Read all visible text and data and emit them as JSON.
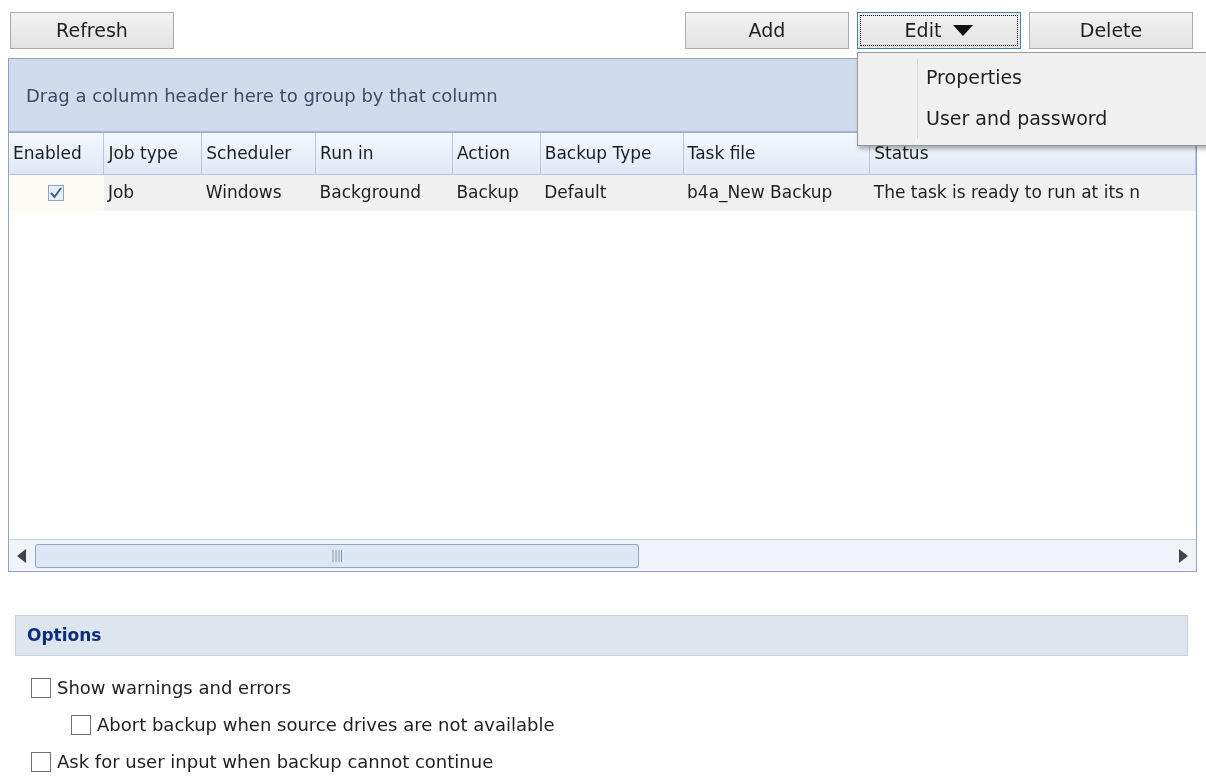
{
  "toolbar": {
    "left_buttons": [
      {
        "label": "Refresh"
      }
    ],
    "right_buttons": [
      {
        "label": "Add",
        "kind": "plain"
      },
      {
        "label": "Edit",
        "kind": "dropdown",
        "expanded": true
      },
      {
        "label": "Delete",
        "kind": "plain"
      }
    ]
  },
  "menu": {
    "items": [
      {
        "label": "Properties"
      },
      {
        "label": "User and password"
      }
    ]
  },
  "grid": {
    "group_hint": "Drag a column header here to group by that column",
    "columns": [
      "Enabled",
      "Job type",
      "Scheduler",
      "Run in",
      "Action",
      "Backup Type",
      "Task file",
      "Status"
    ],
    "rows": [
      {
        "cells": [
          {
            "kind": "checkbox",
            "checked": true
          },
          {
            "kind": "text",
            "text": "Job"
          },
          {
            "kind": "text",
            "text": "Windows"
          },
          {
            "kind": "text",
            "text": "Background"
          },
          {
            "kind": "text",
            "text": "Backup"
          },
          {
            "kind": "text",
            "text": "Default"
          },
          {
            "kind": "text",
            "text": "b4a_New Backup"
          },
          {
            "kind": "text",
            "text": "The task is ready to run at its n"
          }
        ]
      }
    ]
  },
  "options": {
    "title": "Options",
    "items": [
      {
        "label": "Show warnings and errors",
        "checked": false,
        "children": [
          {
            "label": "Abort backup when source drives are not available",
            "checked": false
          }
        ]
      },
      {
        "label": "Ask for user input when backup cannot continue",
        "checked": false
      }
    ]
  }
}
